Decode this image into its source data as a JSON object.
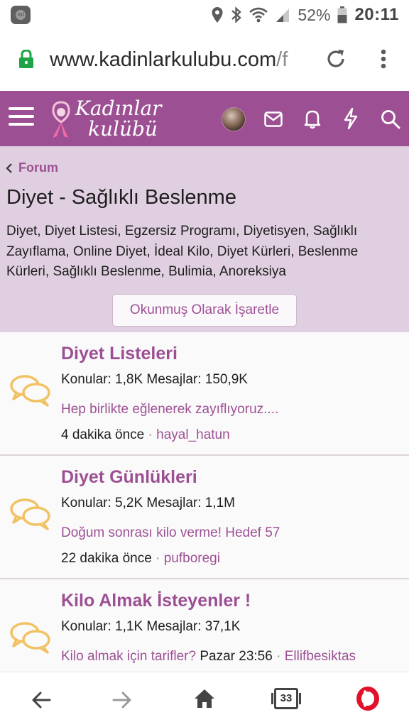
{
  "status_bar": {
    "battery": "52%",
    "time": "20:11",
    "icons": [
      "mi-notification-icon",
      "location-icon",
      "bluetooth-icon",
      "wifi-icon",
      "signal-icon",
      "battery-icon"
    ]
  },
  "browser": {
    "url_main": "www.kadinlarkulubu.com",
    "url_dim": "/f"
  },
  "site": {
    "logo_line1": "Kadınlar",
    "logo_line2": "kulübü",
    "brand_color": "#9c5093",
    "header_icons": [
      "menu-icon",
      "avatar",
      "mail-icon",
      "bell-icon",
      "lightning-icon",
      "search-icon"
    ]
  },
  "forum": {
    "breadcrumb": "Forum",
    "title": "Diyet - Sağlıklı Beslenme",
    "description": "Diyet, Diyet Listesi, Egzersiz Programı, Diyetisyen, Sağlıklı Zayıflama, Online Diyet, İdeal Kilo, Diyet Kürleri, Beslenme Kürleri, Sağlıklı Beslenme, Bulimia, Anoreksiya",
    "mark_read_label": "Okunmuş Olarak İşaretle"
  },
  "subforums": [
    {
      "title": "Diyet Listeleri",
      "stats": "Konular: 1,8K Mesajlar: 150,9K",
      "latest_thread": "Hep birlikte eğlenerek zayıflıyoruz....",
      "latest_time": "4 dakika önce",
      "latest_author": "hayal_hatun"
    },
    {
      "title": "Diyet Günlükleri",
      "stats": "Konular: 5,2K Mesajlar: 1,1M",
      "latest_thread": "Doğum sonrası kilo verme! Hedef 57",
      "latest_time": "22 dakika önce",
      "latest_author": "pufboregi"
    },
    {
      "title": "Kilo Almak İsteyenler !",
      "stats": "Konular: 1,1K Mesajlar: 37,1K",
      "latest_thread": "Kilo almak için tarifler?",
      "latest_time": "Pazar 23:56",
      "latest_author": "Ellifbesiktas"
    }
  ],
  "bottom_nav": {
    "tab_count": "33",
    "icons": [
      "back-arrow-icon",
      "forward-arrow-icon",
      "home-icon",
      "tabs-icon",
      "opera-icon"
    ]
  }
}
